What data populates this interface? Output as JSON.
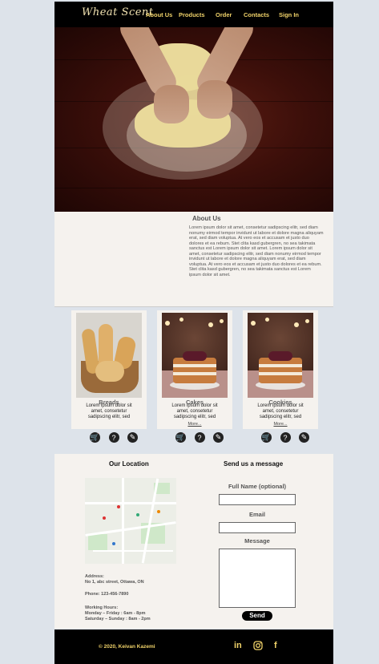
{
  "nav": {
    "logo": "Wheat Scent",
    "links": [
      "About Us",
      "Products",
      "Order",
      "Contacts",
      "Sign In"
    ]
  },
  "about": {
    "title": "About Us",
    "body": "Lorem ipsum dolor sit amet, consetetur sadipscing elitr, sed diam nonumy eirmod tempor invidunt ut labore et dolore magna aliquyam erat, sed diam voluptua. At vero eos et accusam et justo duo dolores et ea rebum. Stet clita kasd gubergren, no sea takimata sanctus est Lorem ipsum dolor sit amet. Lorem ipsum dolor sit amet, consetetur sadipscing elitr, sed diam nonumy eirmod tempor invidunt ut labore et dolore magna aliquyam erat, sed diam voluptua. At vero eos et accusam et justo duo dolores et ea rebum. Stet clita kasd gubergren, no sea takimata sanctus est Lorem ipsum dolor sit amet."
  },
  "products": [
    {
      "title": "Breads",
      "desc": "Lorem ipsum dolor sit amet, consetetur sadipscing elitr, sed",
      "more": ""
    },
    {
      "title": "Cakes",
      "desc": "Lorem ipsum dolor sit amet, consetetur sadipscing elitr, sed",
      "more": "More..."
    },
    {
      "title": "Cookies",
      "desc": "Lorem ipsum dolor sit amet, consetetur sadipscing elitr, sed",
      "more": "More..."
    }
  ],
  "product_icons": [
    "basket-icon",
    "help-icon",
    "edit-icon"
  ],
  "contact": {
    "location_title": "Our Location",
    "address_label": "Address:",
    "address": "No 1, abc street,  Ottawa, ON",
    "phone": "Phone:  123-456-7890",
    "hours_label": "Working Hours:",
    "hours_1": "Monday – Friday      : 6am - 8pm",
    "hours_2": "Saturday – Sunday   : 8am - 2pm",
    "message_title": "Send us a message",
    "name_label": "Full Name (optional)",
    "email_label": "Email",
    "message_label": "Message",
    "send_label": "Send"
  },
  "footer": {
    "copyright": "© 2020, Keivan Kazemi",
    "social": [
      "linkedin-icon",
      "instagram-icon",
      "facebook-icon"
    ]
  },
  "colors": {
    "accent": "#f1d36a",
    "dark": "#000000",
    "panel": "#f5f2ee"
  }
}
